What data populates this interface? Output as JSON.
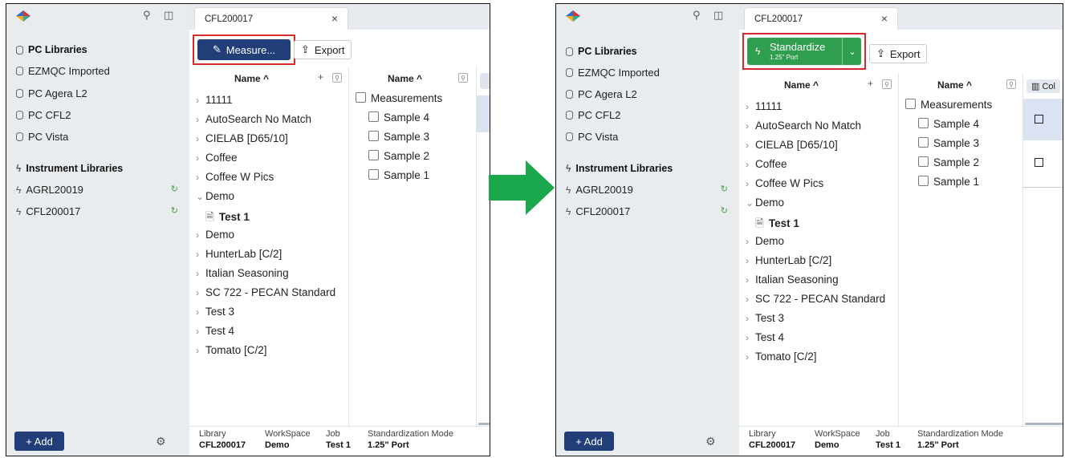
{
  "sidebar": {
    "pc_header": "PC Libraries",
    "pc_items": [
      "EZMQC Imported",
      "PC Agera L2",
      "PC CFL2",
      "PC Vista"
    ],
    "instr_header": "Instrument Libraries",
    "instr_items": [
      "AGRL20019",
      "CFL200017"
    ],
    "add_label": "+ Add"
  },
  "tab": {
    "title": "CFL200017",
    "close": "×"
  },
  "toolbar": {
    "measure_label": "Measure...",
    "export_label": "Export",
    "standardize_label": "Standardize",
    "standardize_sub": "1.25\" Port"
  },
  "jobs_col": {
    "header": "Name ^",
    "plus": "+"
  },
  "tree": [
    "11111",
    "AutoSearch No Match",
    "CIELAB [D65/10]",
    "Coffee",
    "Coffee W Pics",
    "Demo",
    "Test 1",
    "Demo",
    "HunterLab [C/2]",
    "Italian Seasoning",
    "SC 722 - PECAN Standard",
    "Test 3",
    "Test 4",
    "Tomato [C/2]"
  ],
  "samples_col": {
    "header": "Name ^",
    "items": [
      "Measurements",
      "Sample 4",
      "Sample 3",
      "Sample 2",
      "Sample 1"
    ]
  },
  "grid": {
    "columns_label": "Col"
  },
  "status": {
    "library_label": "Library",
    "library_value": "CFL200017",
    "workspace_label": "WorkSpace",
    "workspace_value": "Demo",
    "job_label": "Job",
    "job_value": "Test 1",
    "mode_label": "Standardization Mode",
    "mode_value": "1.25\" Port"
  },
  "colors": {
    "navy": "#213e78",
    "green": "#2f9e4f",
    "highlight": "#d42a2a",
    "arrow": "#1ba74c"
  }
}
